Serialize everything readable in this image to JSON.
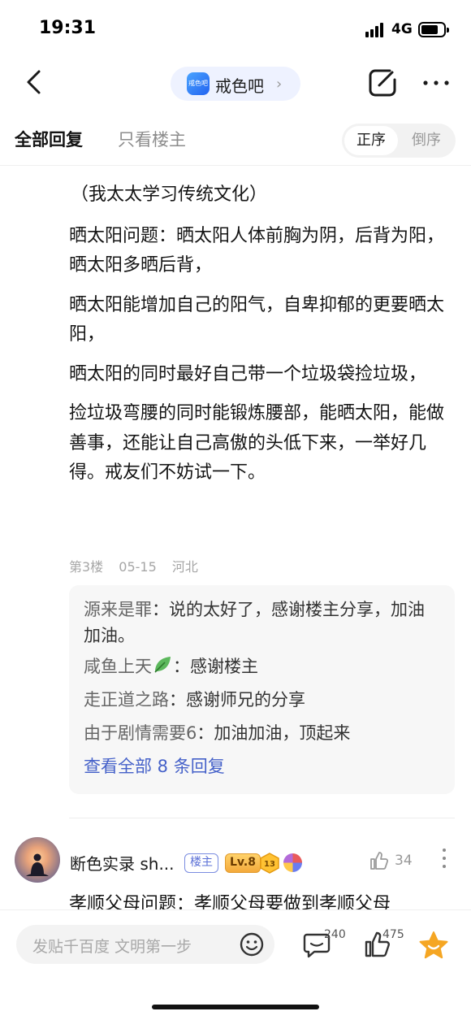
{
  "status": {
    "time": "19:31",
    "network": "4G"
  },
  "nav": {
    "forum_logo_text": "戒色吧",
    "forum_name": "戒色吧"
  },
  "tabs": {
    "all": "全部回复",
    "lz_only": "只看楼主",
    "sort_asc": "正序",
    "sort_desc": "倒序"
  },
  "post": {
    "paragraphs": [
      "（我太太学习传统文化）",
      "晒太阳问题：晒太阳人体前胸为阴，后背为阳，晒太阳多晒后背，",
      "晒太阳能增加自己的阳气，自卑抑郁的更要晒太阳，",
      "晒太阳的同时最好自己带一个垃圾袋捡垃圾，",
      "捡垃圾弯腰的同时能锻炼腰部，能晒太阳，能做善事，还能让自己高傲的头低下来，一举好几得。戒友们不妨试一下。"
    ],
    "floor": "第3楼",
    "date": "05-15",
    "location": "河北"
  },
  "replies": {
    "items": [
      {
        "author": "源来是罪",
        "sep": "：",
        "text": "说的太好了，感谢楼主分享，加油加油。"
      },
      {
        "author": "咸鱼上天",
        "sep": "：",
        "text": "感谢楼主",
        "icon": "leaf-icon"
      },
      {
        "author": "走正道之路",
        "sep": "：",
        "text": "感谢师兄的分享"
      },
      {
        "author": "由于剧情需要6",
        "sep": "：",
        "text": "加油加油，顶起来"
      }
    ],
    "view_all": "查看全部 8 条回复"
  },
  "next_floor": {
    "username": "断色实录 sh...",
    "badge_lz": "楼主",
    "badge_level": "Lv.8",
    "badge_num": "13",
    "likes": "34",
    "text": "孝顺父母问题：孝顺父母要做到孝顺父母"
  },
  "bottom": {
    "placeholder": "发贴千百度 文明第一步",
    "comment_count": "240",
    "like_count": "475"
  },
  "colors": {
    "accent": "#4561c9",
    "star": "#f5a623",
    "link": "#4561c9"
  }
}
